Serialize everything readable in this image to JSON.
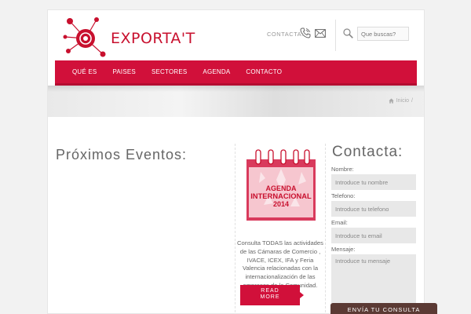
{
  "header": {
    "logo_text": "EXPORTA'T",
    "contacta_label": "CONTACTA:",
    "search_placeholder": "Que buscas?"
  },
  "nav": {
    "items": [
      {
        "label": "QUÉ ES"
      },
      {
        "label": "PAISES"
      },
      {
        "label": "SECTORES"
      },
      {
        "label": "AGENDA"
      },
      {
        "label": "CONTACTO"
      }
    ]
  },
  "breadcrumb": {
    "home_label": "Inicio",
    "separator": "/"
  },
  "events": {
    "title": "Próximos Eventos:"
  },
  "promo": {
    "calendar_line1": "AGENDA",
    "calendar_line2": "INTERNACIONAL",
    "calendar_year": "2014",
    "description": "Consulta TODAS las actividades de las Cámaras de Comercio , IVACE, ICEX, IFA y Feria Valencia relacionadas con la internacionalización de las empresas de la Comunidad.",
    "read_more_line1": "READ",
    "read_more_line2": "MORE"
  },
  "contact_form": {
    "title": "Contacta:",
    "name_label": "Nombre:",
    "name_placeholder": "Introduce tu nombre",
    "phone_label": "Telefono:",
    "phone_placeholder": "Introduce tu telefono",
    "email_label": "Email:",
    "email_placeholder": "Introduce tu email",
    "message_label": "Mensaje:",
    "message_placeholder": "Introduce tu mensaje",
    "submit_label": "ENVÍA TU CONSULTA"
  },
  "colors": {
    "brand_red": "#d1103a",
    "submit_brown": "#5b3a34"
  }
}
